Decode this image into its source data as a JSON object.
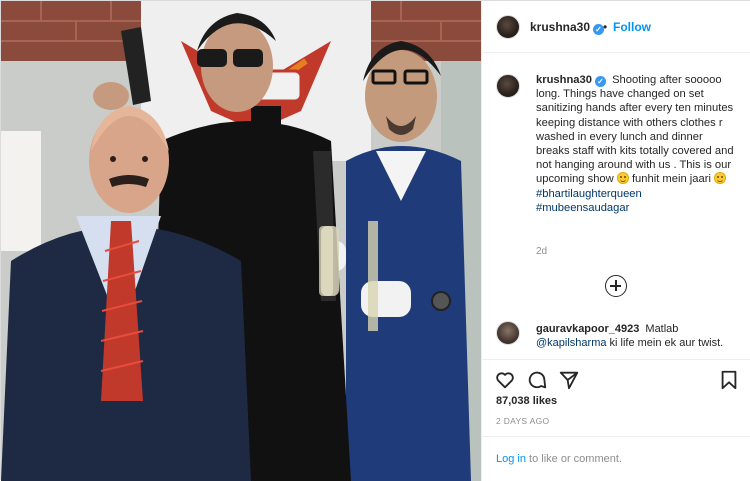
{
  "post": {
    "author": "krushna30",
    "follow_label": "Follow",
    "separator": "•",
    "caption": {
      "text": "Shooting after sooooo long. Things have changed on set sanitizing hands after every ten minutes keeping distance with others clothes r washed in every lunch and dinner breaks staff with kits totally covered and not hanging around with us . This is our upcoming show",
      "text_2": "funhit mein jaari",
      "hashtags": [
        "#bhartilaughterqueen",
        "#mubeensaudagar"
      ],
      "time": "2d"
    },
    "comment": {
      "author": "gauravkapoor_4923",
      "text_start": "Matlab",
      "mention": "@kapilsharma",
      "text_end": "ki life mein ek aur twist."
    },
    "likes": "87,038 likes",
    "date": "2 DAYS AGO",
    "login": {
      "link": "Log in",
      "rest": "to like or comment."
    }
  },
  "icons": {
    "like": "heart-icon",
    "comment": "comment-bubble-icon",
    "share": "paper-plane-icon",
    "save": "bookmark-icon",
    "more": "plus-circle-icon",
    "verified": "verified-badge-icon"
  },
  "colors": {
    "accent": "#0095f6",
    "hashtag": "#00376b",
    "muted": "#8e8e8e",
    "verified": "#3897f0"
  }
}
